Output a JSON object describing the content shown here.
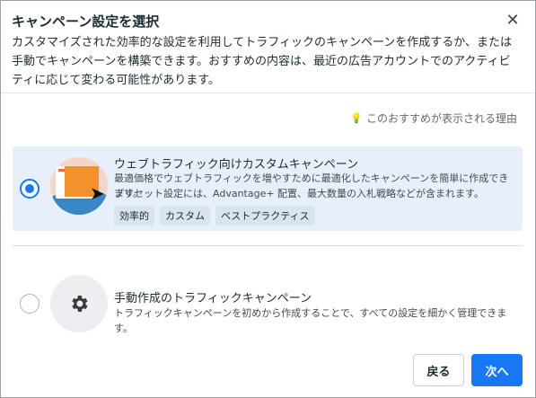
{
  "dialog": {
    "title": "キャンペーン設定を選択",
    "description": "カスタマイズされた効率的な設定を利用してトラフィックのキャンペーンを作成するか、または手動でキャンペーンを構築できます。おすすめの内容は、最近の広告アカウントでのアクティビティに応じて変わる可能性があります。",
    "why_link": "このおすすめが表示される理由",
    "close_icon": "close-icon"
  },
  "options": [
    {
      "title": "ウェブトラフィック向けカスタムキャンペーン",
      "description_line1": "最適価格でウェブトラフィックを増やすために最適化したキャンペーンを簡単に作成できます。",
      "description_line2": "プリセット設定には、Advantage+ 配置、最大数量の入札戦略などが含まれます。",
      "tags": [
        "効率的",
        "カスタム",
        "ベストプラクティス"
      ],
      "selected": true,
      "icon": "web-traffic-illustration"
    },
    {
      "title": "手動作成のトラフィックキャンペーン",
      "description_line1": "トラフィックキャンペーンを初めから作成することで、すべての設定を細かく管理できます。",
      "selected": false,
      "icon": "gear-icon"
    }
  ],
  "buttons": {
    "back": "戻る",
    "next": "次へ"
  },
  "colors": {
    "primary": "#1877f2",
    "selected_bg": "#e7f0fa"
  }
}
